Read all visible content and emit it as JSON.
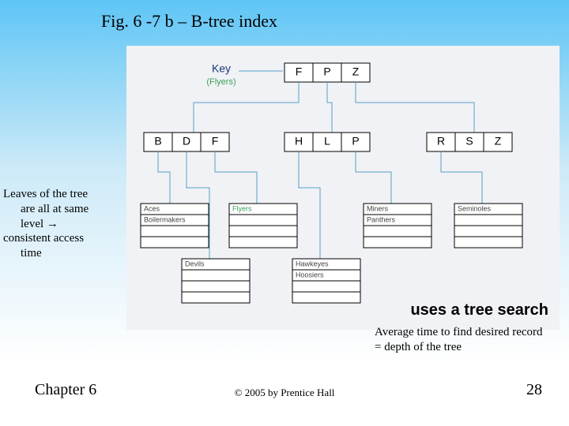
{
  "title": "Fig. 6 -7 b – B-tree index",
  "key": {
    "label": "Key",
    "example": "(Flyers)"
  },
  "root": [
    "F",
    "P",
    "Z"
  ],
  "mid": {
    "left": [
      "B",
      "D",
      "F"
    ],
    "center": [
      "H",
      "L",
      "P"
    ],
    "right": [
      "R",
      "S",
      "Z"
    ]
  },
  "leaves": {
    "c1": [
      "Aces",
      "Boilermakers",
      "",
      ""
    ],
    "c2": [
      "Devils",
      "",
      "",
      ""
    ],
    "c3": [
      "Flyers",
      "",
      "",
      ""
    ],
    "c4": [
      "Hawkeyes",
      "Hoosiers",
      "",
      ""
    ],
    "c5": [
      "Miners",
      "Panthers",
      "",
      ""
    ],
    "c6": [
      "Seminoles",
      "",
      "",
      ""
    ]
  },
  "side_note": {
    "l1": "Leaves of the tree",
    "l2": "are all at same",
    "l3": "level →",
    "l4": "consistent access",
    "l5": "time"
  },
  "uses_text": "uses a tree search",
  "avg_text": "Average time to find desired record = depth of the tree",
  "footer": {
    "chapter": "Chapter 6",
    "copyright": "© 2005 by Prentice Hall",
    "page": "28"
  }
}
